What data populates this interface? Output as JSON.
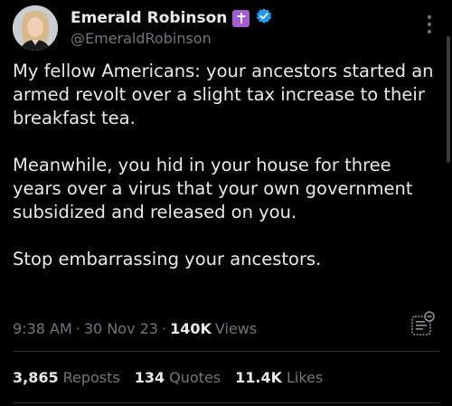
{
  "author": {
    "display_name": "Emerald Robinson",
    "handle": "@EmeraldRobinson",
    "badge_icon": "cross-icon",
    "verified_icon": "verified-check-icon",
    "colors": {
      "badge": "#a65bd4",
      "verified": "#1d9bf0"
    }
  },
  "tweet": {
    "paragraphs": [
      "My fellow Americans: your ancestors started an armed revolt over a slight tax increase to their breakfast tea.",
      "Meanwhile, you hid in your house for three years over a virus that your own government subsidized and released on you.",
      "Stop embarrassing your ancestors."
    ],
    "time": "9:38 AM",
    "separator": "·",
    "date": "30 Nov 23",
    "views_count": "140K",
    "views_label": "Views"
  },
  "stats": [
    {
      "value": "3,865",
      "label": "Reposts"
    },
    {
      "value": "134",
      "label": "Quotes"
    },
    {
      "value": "11.4K",
      "label": "Likes"
    }
  ],
  "icons": {
    "more": "more-vertical-icon",
    "analytics": "analytics-icon"
  },
  "colors": {
    "background": "#000000",
    "text": "#e7e9ea",
    "muted": "#71767b",
    "divider": "#2f3336"
  }
}
